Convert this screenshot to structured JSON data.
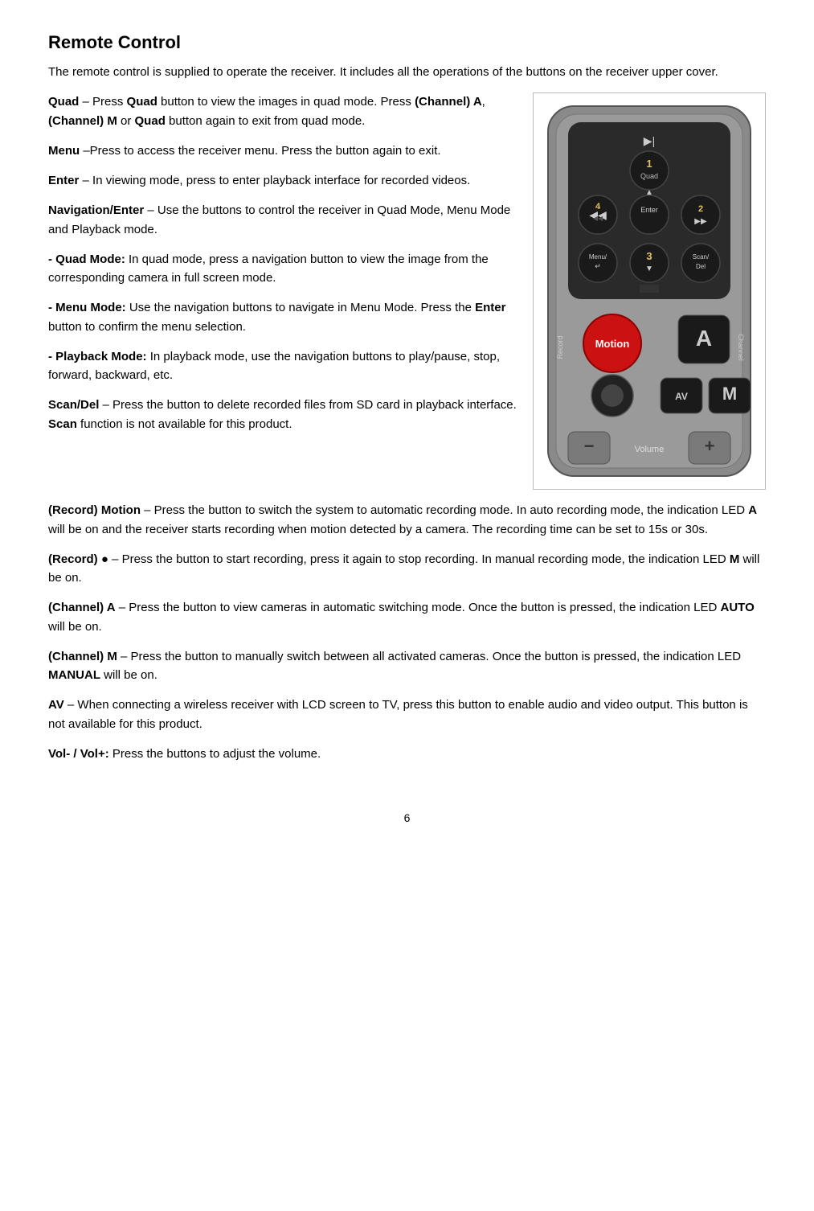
{
  "title": "Remote Control",
  "intro": "The remote control is supplied to operate the receiver. It includes all the operations of the buttons on the receiver upper cover.",
  "paragraphs": [
    {
      "id": "quad",
      "html": "<b>Quad</b> – Press <b>Quad</b> button to view the images in quad mode. Press <b>(Channel) A</b>, <b>(Channel) M</b> or <b>Quad</b> button again to exit from quad mode."
    },
    {
      "id": "menu",
      "html": "<b>Menu</b> –Press to access the receiver menu. Press the button again to exit."
    },
    {
      "id": "enter",
      "html": "<b>Enter</b> – In viewing mode, press to enter playback interface for recorded videos."
    },
    {
      "id": "nav-enter",
      "html": "<b>Navigation/Enter</b> – Use the buttons to control the receiver in Quad Mode, Menu Mode and Playback mode."
    },
    {
      "id": "quad-mode",
      "html": "<b>- Quad Mode:</b> In quad mode, press a navigation button to view the image from the corresponding camera in full screen mode."
    },
    {
      "id": "menu-mode",
      "html": "<b>- Menu Mode:</b> Use the navigation buttons to navigate in Menu Mode. Press the <b>Enter</b> button to confirm the menu selection."
    },
    {
      "id": "playback-mode",
      "html": "<b>- Playback Mode:</b> In playback mode, use the navigation buttons to play/pause, stop, forward, backward, etc."
    },
    {
      "id": "scan-del",
      "html": "<b>Scan/Del</b> – Press the button to delete recorded files from SD card in playback interface. <b>Scan</b> function is not available for this product."
    }
  ],
  "paragraphs_below": [
    {
      "id": "record-motion",
      "html": "<b>(Record) Motion</b> – Press the button to switch the system to automatic recording mode. In auto recording mode, the indication LED <b>A</b> will be on and the receiver starts recording when motion detected by a camera. The recording time can be set to 15s or 30s."
    },
    {
      "id": "record-dot",
      "html": "<b>(Record) ●</b> – Press the button to start recording, press it again to stop recording. In manual recording mode, the indication LED <b>M</b> will be on."
    },
    {
      "id": "channel-a",
      "html": "<b>(Channel) A</b> – Press the button to view cameras in automatic switching mode. Once the button is pressed, the indication LED <b>AUTO</b> will be on."
    },
    {
      "id": "channel-m",
      "html": "<b>(Channel) M</b> – Press the button to manually switch between all activated cameras. Once the button is pressed, the indication LED <b>MANUAL</b> will be on."
    },
    {
      "id": "av",
      "html": "<b>AV</b> – When connecting a wireless receiver with LCD screen to TV, press this button to enable audio and video output. This button is not available for this product."
    },
    {
      "id": "vol",
      "html": "<b>Vol- / Vol+:</b> Press the buttons to adjust the volume."
    }
  ],
  "page_number": "6"
}
